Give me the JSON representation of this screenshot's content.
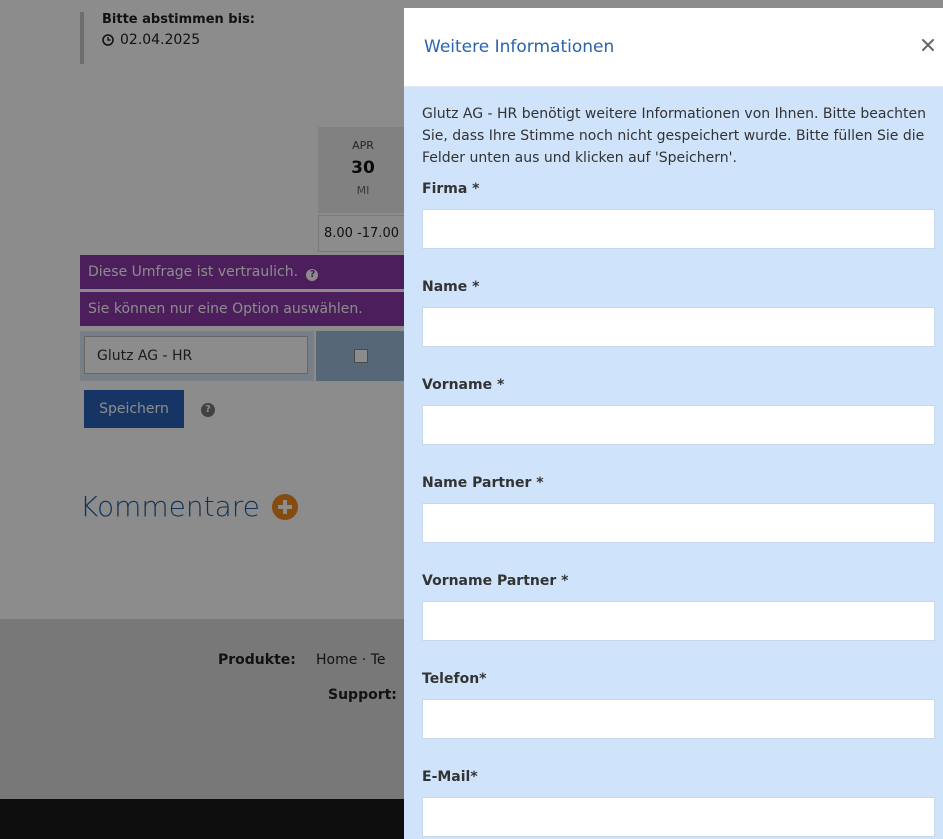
{
  "vote_deadline": {
    "label": "Bitte abstimmen bis:",
    "date": "02.04.2025"
  },
  "date_column": {
    "month": "APR",
    "day": "30",
    "weekday": "MI",
    "time": "8.00 -17.00"
  },
  "notices": {
    "confidential": "Diese Umfrage ist vertraulich.",
    "single_choice": "Sie können nur eine Option auswählen."
  },
  "participant": {
    "name": "Glutz AG - HR"
  },
  "save_button": "Speichern",
  "comments": {
    "title": "Kommentare"
  },
  "footer": {
    "products_label": "Produkte:",
    "products_links": "Home  ·  Te",
    "support_label": "Support:"
  },
  "modal": {
    "title": "Weitere Informationen",
    "intro": "Glutz AG - HR benötigt weitere Informationen von Ihnen. Bitte beachten Sie, dass Ihre Stimme noch nicht gespeichert wurde. Bitte füllen Sie die Felder unten aus und klicken auf 'Speichern'.",
    "fields": [
      {
        "label": "Firma *",
        "value": ""
      },
      {
        "label": "Name *",
        "value": ""
      },
      {
        "label": "Vorname *",
        "value": ""
      },
      {
        "label": "Name Partner *",
        "value": ""
      },
      {
        "label": "Vorname Partner *",
        "value": ""
      },
      {
        "label": "Telefon*",
        "value": ""
      },
      {
        "label": "E-Mail*",
        "value": ""
      }
    ]
  },
  "colors": {
    "purple_bar": "#8b37a8",
    "primary_button": "#2b62b6",
    "modal_title": "#2a64ab",
    "modal_body_bg": "#cfe3fb",
    "comments_plus": "#f28a1f"
  }
}
